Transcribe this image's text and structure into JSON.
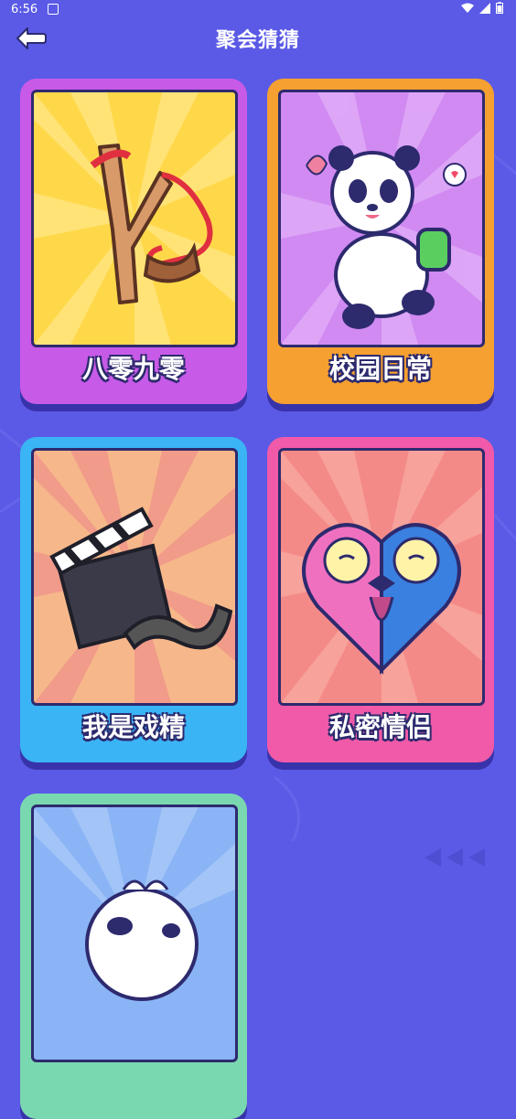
{
  "status_bar": {
    "time": "6:56"
  },
  "header": {
    "title": "聚会猜猜",
    "back_icon": "back-arrow-icon"
  },
  "cards": [
    {
      "label": "八零九零",
      "icon": "slingshot-icon",
      "frame_color": "#c85ae8",
      "bg_color": "#ffd84a"
    },
    {
      "label": "校园日常",
      "icon": "panda-icon",
      "frame_color": "#f5a030",
      "bg_color": "#d08af2"
    },
    {
      "label": "我是戏精",
      "icon": "clapperboard-icon",
      "frame_color": "#3ab4f5",
      "bg_color": "#f6b88a"
    },
    {
      "label": "私密情侣",
      "icon": "lovebirds-icon",
      "frame_color": "#f05aa8",
      "bg_color": "#f48a88"
    },
    {
      "label": "",
      "icon": "cow-icon",
      "frame_color": "#7ad8b0",
      "bg_color": "#8ab4f5"
    }
  ]
}
